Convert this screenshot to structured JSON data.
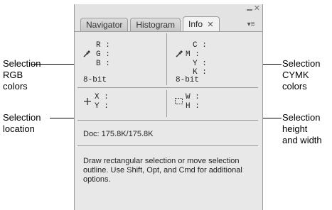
{
  "panel": {
    "tabs": [
      {
        "label": "Navigator",
        "active": false
      },
      {
        "label": "Histogram",
        "active": false
      },
      {
        "label": "Info",
        "active": true
      }
    ],
    "tab_close_glyph": "✕",
    "menu_glyph": "▾≡",
    "rgb": {
      "labels": [
        "R :",
        "G :",
        "B :"
      ],
      "bit_depth": "8-bit",
      "icon": "eyedropper-icon"
    },
    "cmyk": {
      "labels": [
        "C :",
        "M :",
        "Y :",
        "K :"
      ],
      "bit_depth": "8-bit",
      "icon": "eyedropper-icon"
    },
    "location": {
      "labels": [
        "X :",
        "Y :"
      ],
      "icon": "crosshair-icon"
    },
    "size": {
      "labels": [
        "W :",
        "H :"
      ],
      "icon": "selection-rect-icon"
    },
    "doc_info": "Doc: 175.8K/175.8K",
    "description": "Draw rectangular selection or move selection outline.  Use Shift, Opt, and Cmd for additional options."
  },
  "callouts": {
    "rgb": "Selection\nRGB\ncolors",
    "location": "Selection\nlocation",
    "cmyk": "Selection\nCYMK\ncolors",
    "size": "Selection\nheight\nand width"
  }
}
